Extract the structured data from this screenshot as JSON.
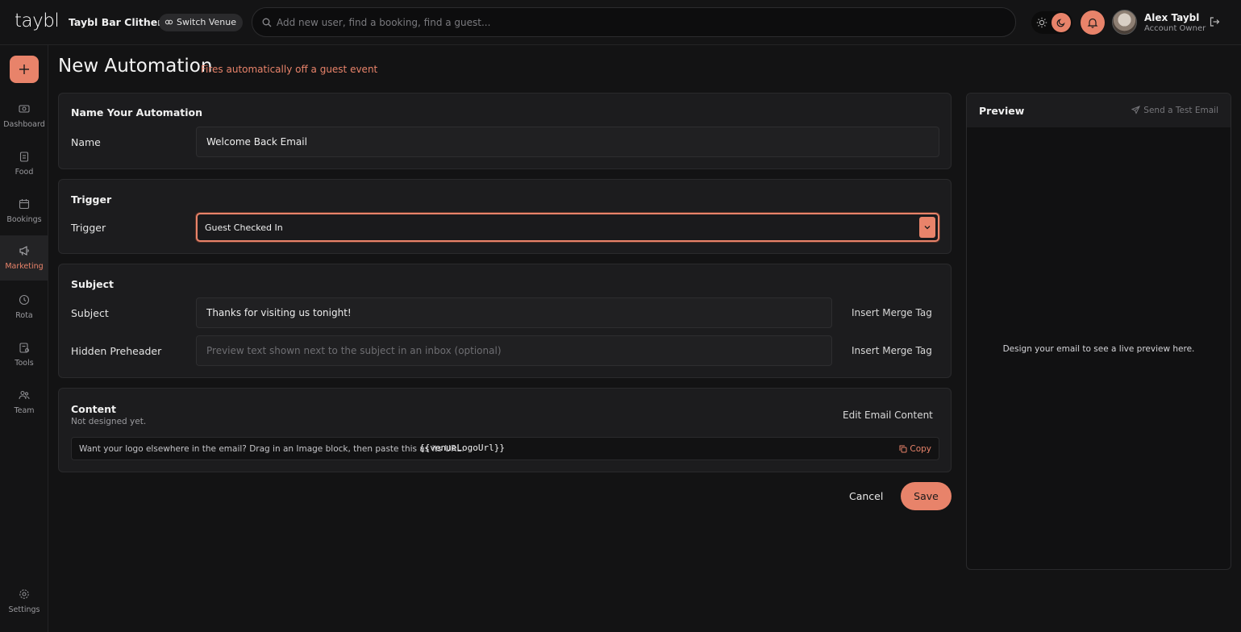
{
  "topbar": {
    "logo": "taybl",
    "venue_name": "Taybl Bar Clitheroe",
    "switch_venue": "Switch Venue",
    "search_placeholder": "Add new user, find a booking, find a guest...",
    "user_name": "Alex Taybl",
    "user_role": "Account Owner"
  },
  "sidebar": {
    "items": [
      {
        "label": "Dashboard",
        "icon": "dashboard-icon"
      },
      {
        "label": "Food",
        "icon": "food-icon"
      },
      {
        "label": "Bookings",
        "icon": "bookings-icon"
      },
      {
        "label": "Marketing",
        "icon": "megaphone-icon",
        "active": true
      },
      {
        "label": "Rota",
        "icon": "rota-icon"
      },
      {
        "label": "Tools",
        "icon": "tools-icon"
      },
      {
        "label": "Team",
        "icon": "team-icon"
      },
      {
        "label": "Settings",
        "icon": "settings-icon"
      }
    ]
  },
  "page": {
    "title": "New Automation",
    "subtitle": "Fires automatically off a guest event"
  },
  "name_card": {
    "title": "Name Your Automation",
    "label": "Name",
    "value": "Welcome Back Email"
  },
  "trigger_card": {
    "title": "Trigger",
    "label": "Trigger",
    "value": "Guest Checked In"
  },
  "subject_card": {
    "title": "Subject",
    "subject_label": "Subject",
    "subject_value": "Thanks for visiting us tonight!",
    "preheader_label": "Hidden Preheader",
    "preheader_placeholder": "Preview text shown next to the subject in an inbox (optional)",
    "merge_tag": "Insert Merge Tag"
  },
  "content_card": {
    "title": "Content",
    "status": "Not designed yet.",
    "edit": "Edit Email Content",
    "hint": "Want your logo elsewhere in the email? Drag in an Image block, then paste this as its URL:",
    "code": "{{venueLogoUrl}}",
    "copy": "Copy"
  },
  "actions": {
    "cancel": "Cancel",
    "save": "Save"
  },
  "preview": {
    "title": "Preview",
    "send_test": "Send a Test Email",
    "empty": "Design your email to see a live preview here."
  },
  "colors": {
    "accent": "#e8836a",
    "background": "#131314",
    "card": "#1c1c1e"
  }
}
